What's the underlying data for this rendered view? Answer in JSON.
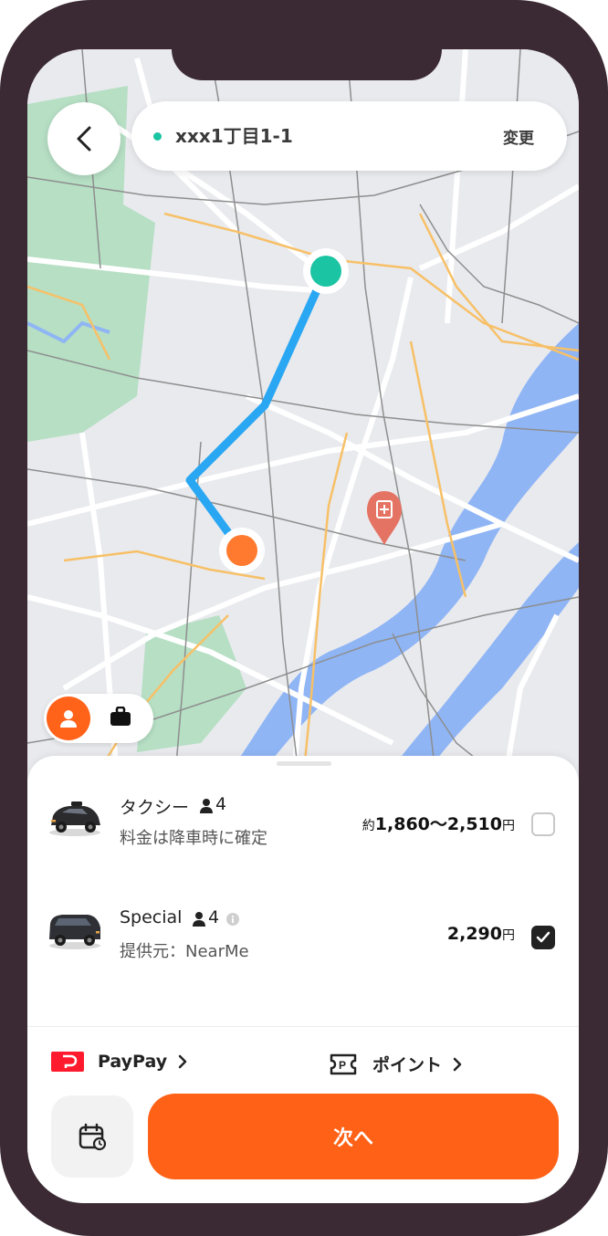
{
  "search": {
    "address": "xxx1丁目1-1",
    "change_label": "変更"
  },
  "rides": [
    {
      "name": "タクシー",
      "capacity": "4",
      "subtitle": "料金は降車時に確定",
      "price_prefix": "約",
      "price": "1,860〜2,510",
      "currency": "円",
      "selected": false
    },
    {
      "name": "Special",
      "capacity": "4",
      "subtitle": "提供元：NearMe",
      "price_prefix": "",
      "price": "2,290",
      "currency": "円",
      "selected": true
    }
  ],
  "payment": {
    "method": "PayPay",
    "points_label": "ポイント"
  },
  "actions": {
    "next_label": "次へ"
  },
  "icons": {
    "back": "chevron-left-icon",
    "person": "person-icon",
    "briefcase": "briefcase-icon",
    "calendar": "calendar-clock-icon",
    "hospital": "hospital-pin-icon",
    "paypay": "paypay-logo",
    "points": "points-ticket-icon",
    "info": "info-icon"
  },
  "colors": {
    "accent": "#ff6116",
    "origin_pin": "#1bc4a2",
    "destination_pin": "#ff7a2e",
    "route": "#2aa7f2",
    "frame": "#3b2a33"
  }
}
